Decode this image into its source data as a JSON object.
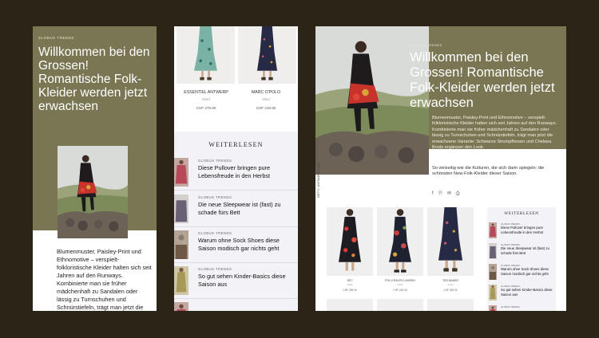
{
  "panel1": {
    "brand": "GLOBUS TRENDS",
    "headline": "Willkommen bei den Grossen! Romantische Folk-Kleider werden jetzt erwachsen",
    "body": "Blumenmuster, Paisley-Print und Ethnomotive – verspielt-folkloristische Kleider halten sich seit Jahren auf den Runways. Kombinierte man sie früher mädchenhaft zu Sandalen oder lässig zu Turnschuhen und Schnürstiefeln, trägt man jetzt die erwachsene Variante: Schwarze"
  },
  "panel2": {
    "products": [
      {
        "brand": "ESSENTIEL ANTWERP",
        "category": "Kleid",
        "price": "CHF 279.90"
      },
      {
        "brand": "MARC O'POLO",
        "category": "Kleid",
        "price": "CHF 219.90"
      }
    ],
    "weiterlesen_title": "WEITERLESEN",
    "articles": [
      {
        "source": "GLOBUS TRENDS",
        "title": "Diese Pullover bringen pure Lebensfreude in den Herbst"
      },
      {
        "source": "GLOBUS TRENDS",
        "title": "Die neue Sleepwear ist (fast) zu schade fürs Bett"
      },
      {
        "source": "GLOBUS TRENDS",
        "title": "Warum ohne Sock Shoes diese Saison modisch gar nichts geht"
      },
      {
        "source": "GLOBUS TRENDS",
        "title": "So gut sehen Kinder-Basics diese Saison aus"
      }
    ]
  },
  "panel3": {
    "brand": "GLOBUS TRENDS",
    "headline": "Willkommen bei den Grossen! Romantische Folk-Kleider werden jetzt erwachsen",
    "photo_credit": "GETTY | INSTAGRAM.COM",
    "body": "Blumenmuster, Paisley-Print und Ethnomotive – verspielt-folkloristische Kleider halten sich seit Jahren auf den Runways. Kombinierte man sie früher mädchenhaft zu Sandalen oder lässig zu Turnschuhen und Schnürstiefeln, trägt man jetzt die erwachsene Variante: Schwarze Strumpfhosen und Chelsea Boots ergänzen den Look.",
    "body2": "So vielseitig wie die Kulturen, die sich darin spiegeln: die schönsten New-Folk-Kleider dieser Saison.",
    "share_icons": "f ⓟ ✉ ⎙",
    "products": [
      {
        "brand": "SET",
        "category": "Kleid",
        "price": "CHF 299.90"
      },
      {
        "brand": "POLO RALPH LAUREN",
        "category": "Kleid",
        "price": "CHF 249.90"
      },
      {
        "brand": "TED BAKER",
        "category": "Kleid",
        "price": "CHF 329.90"
      }
    ],
    "weiterlesen_title": "WEITERLESEN",
    "articles": [
      {
        "source": "GLOBUS TRENDS",
        "title": "Diese Pullover bringen pure Lebensfreude in den Herbst"
      },
      {
        "source": "GLOBUS TRENDS",
        "title": "Die neue Sleepwear ist (fast) zu schade fürs Bett"
      },
      {
        "source": "GLOBUS TRENDS",
        "title": "Warum ohne Sock Shoes diese Saison modisch gar nichts geht"
      },
      {
        "source": "GLOBUS TRENDS",
        "title": "So gut sehen Kinder-Basics diese Saison aus"
      },
      {
        "source": "GLOBUS TRENDS",
        "title": ""
      }
    ]
  },
  "colors": {
    "background": "#2b2518",
    "olive": "#7a7552",
    "sidebar_bg": "#f3f2f7"
  }
}
